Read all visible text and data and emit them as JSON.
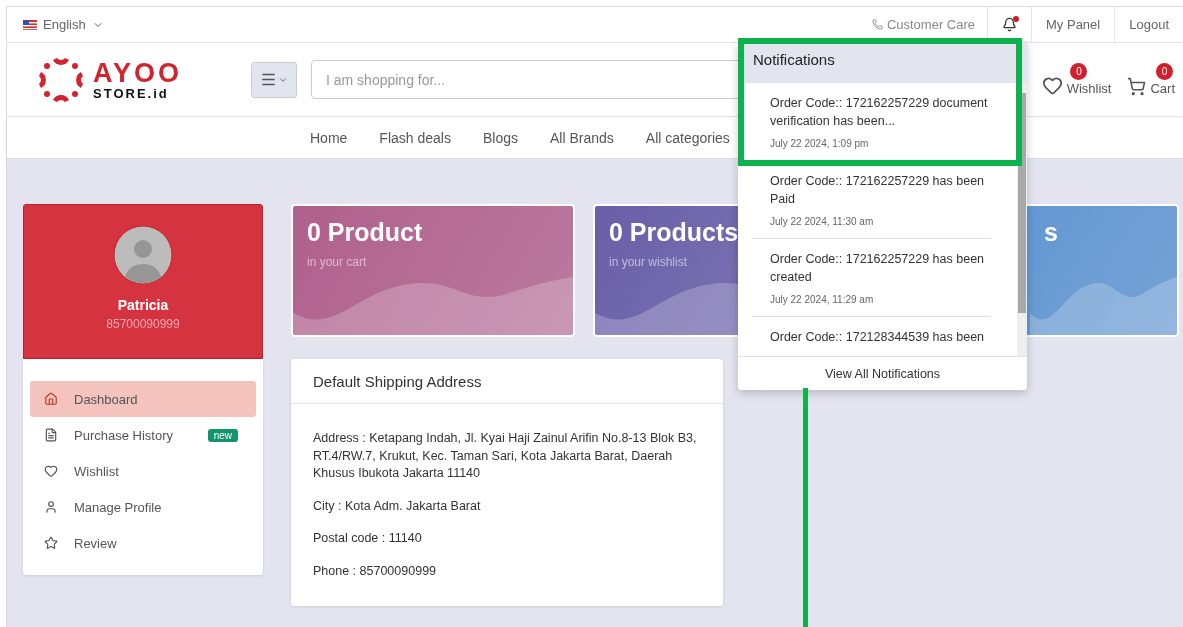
{
  "top_bar": {
    "language": "English",
    "customer_care": "Customer Care",
    "has_unread": true,
    "links": [
      "My Panel",
      "Logout"
    ]
  },
  "header": {
    "logo": {
      "mark": "AYOO",
      "sub": "STORE.id"
    },
    "search": {
      "placeholder": "I am shopping for..."
    },
    "wishlist": {
      "label": "Wishlist",
      "count": "0"
    },
    "cart": {
      "label": "Cart",
      "count": "0"
    }
  },
  "nav": [
    "Home",
    "Flash deals",
    "Blogs",
    "All Brands",
    "All categories"
  ],
  "profile": {
    "name": "Patricia",
    "phone": "85700090999"
  },
  "sidebar": {
    "items": [
      {
        "kind": "home",
        "label": "Dashboard",
        "selected": true
      },
      {
        "kind": "file",
        "label": "Purchase History",
        "selected": false,
        "badge": "new"
      },
      {
        "kind": "heart",
        "label": "Wishlist",
        "selected": false
      },
      {
        "kind": "user",
        "label": "Manage Profile",
        "selected": false
      },
      {
        "kind": "star",
        "label": "Review",
        "selected": false
      }
    ]
  },
  "stat_cards": [
    {
      "title": "0 Product",
      "subtitle": "in your cart",
      "color": "#b0608c"
    },
    {
      "title": "0 Products",
      "subtitle": "in your wishlist",
      "color": "#6a5fa8"
    },
    {
      "title": "s",
      "color": "#5a92cf"
    }
  ],
  "address_card": {
    "title": "Default Shipping Address",
    "lines": [
      "Address : Ketapang Indah, Jl. Kyai Haji Zainul Arifin No.8-13 Blok B3, RT.4/RW.7, Krukut, Kec. Taman Sari, Kota Jakarta Barat, Daerah Khusus Ibukota Jakarta 11140",
      "City : Kota Adm. Jakarta Barat",
      "Postal code : 11140",
      "Phone : 85700090999"
    ]
  },
  "notifications": {
    "title": "Notifications",
    "items": [
      {
        "text": "Order Code:: 172162257229 document verification has been...",
        "time": "July 22 2024, 1:09 pm"
      },
      {
        "text": "Order Code:: 172162257229 has been Paid",
        "time": "July 22 2024, 11:30 am"
      },
      {
        "text": "Order Code:: 172162257229 has been created",
        "time": "July 22 2024, 11:29 am"
      },
      {
        "text": "Order Code:: 172128344539 has been"
      }
    ],
    "footer": "View All Notifications"
  }
}
